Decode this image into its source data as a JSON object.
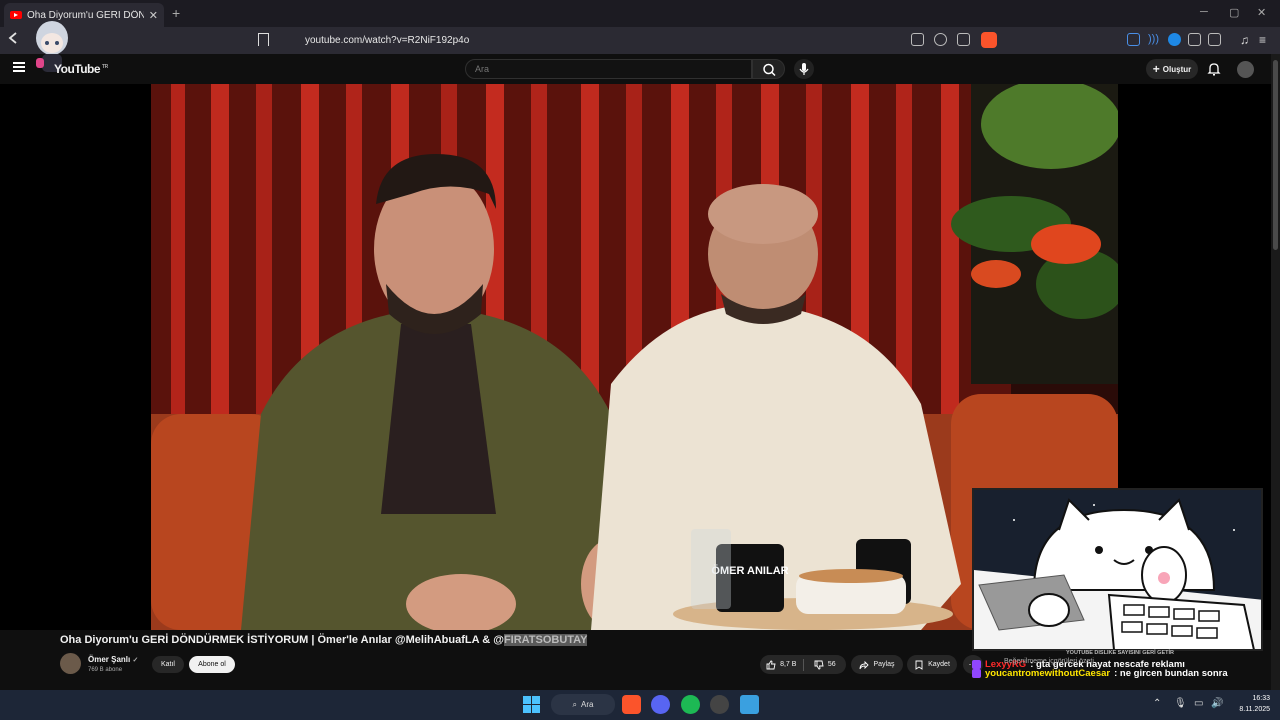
{
  "browser": {
    "tab_title": "Oha Diyorum'u GERİ DÖNDÜ",
    "tab_close": "✕",
    "new_tab": "+",
    "url": "youtube.com/watch?v=R2NiF192p4o",
    "window_controls": [
      "─",
      "▢",
      "✕"
    ]
  },
  "masthead": {
    "logo": "YouTube",
    "country": "TR",
    "search_placeholder": "Ara",
    "create_label": "Oluştur"
  },
  "video": {
    "title_prefix": "Oha Diyorum'u GERİ DÖNDÜRMEK İSTİYORUM | Ömer'le Anılar @MelihAbuafLA & @",
    "title_highlight": "FIRATSOBUTAY",
    "mug_text": "ÖMER ANILAR"
  },
  "channel": {
    "name": "Ömer Şanlı",
    "verified": "✓",
    "subscribers": "769 B abone",
    "join_label": "Katıl",
    "subscribe_label": "Abone ol"
  },
  "actions": {
    "likes": "8,7 B",
    "dislikes": "56",
    "share_label": "Paylaş",
    "save_label": "Kaydet",
    "more_label": "⋯"
  },
  "overlay": {
    "banner": "YOUTUBE DISLIKE SAYISINI GERİ GETİR",
    "ghost_text": "Beğenilmeme içgörüleri özeti",
    "chat": [
      {
        "user": "LexyyRG",
        "message": ": gta gercek hayat nescafe reklamı"
      },
      {
        "user": "youcantromewithoutCaesar",
        "message": ": ne gircen bundan sonra"
      }
    ]
  },
  "taskbar": {
    "search_label": "Ara",
    "time": "16:33",
    "date": "8.11.2025"
  },
  "colors": {
    "accent_red": "#ff0000",
    "chat_user1": "#ff2a2a",
    "chat_user2": "#ffe600",
    "twitch": "#9146ff"
  }
}
